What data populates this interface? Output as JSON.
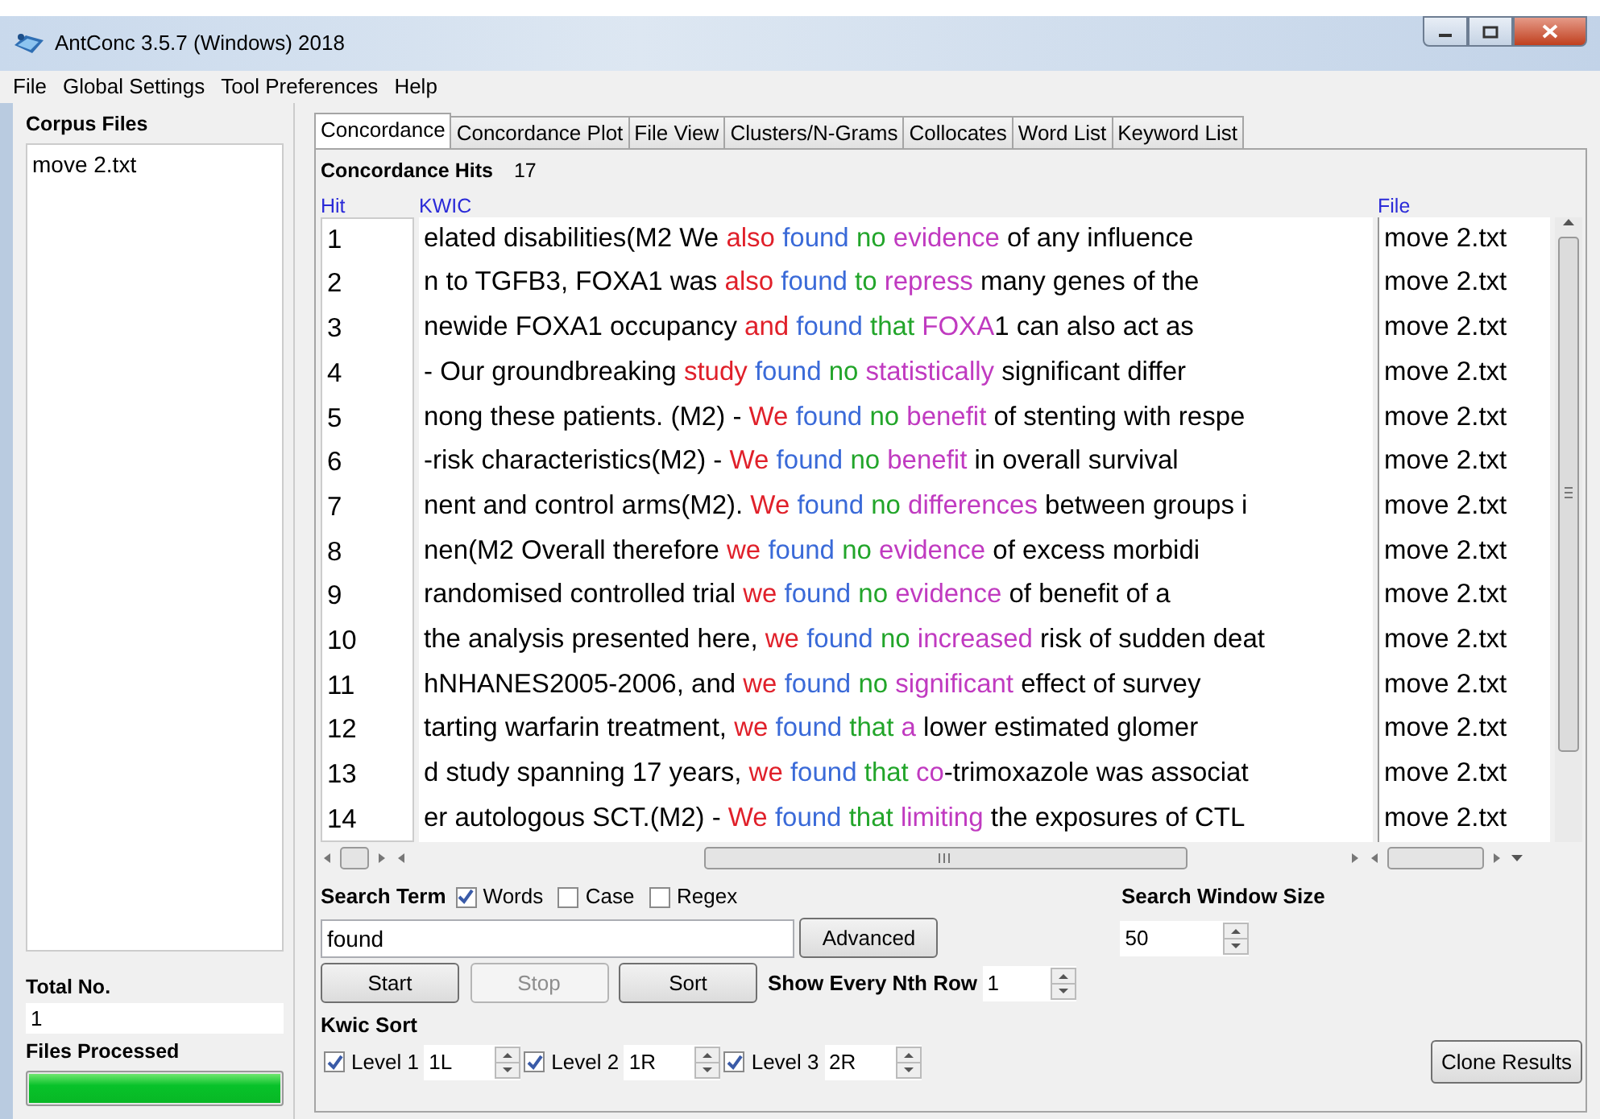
{
  "window": {
    "title": "AntConc 3.5.7 (Windows) 2018"
  },
  "menu": [
    "File",
    "Global Settings",
    "Tool Preferences",
    "Help"
  ],
  "corpus_files": {
    "heading": "Corpus Files",
    "items": [
      "move 2.txt"
    ]
  },
  "total_no": {
    "label": "Total No.",
    "value": "1"
  },
  "files_processed": {
    "label": "Files Processed",
    "level": 1
  },
  "tabs": [
    {
      "label": "Concordance",
      "selected": true
    },
    {
      "label": "Concordance Plot",
      "selected": false
    },
    {
      "label": "File View",
      "selected": false
    },
    {
      "label": "Clusters/N-Grams",
      "selected": false
    },
    {
      "label": "Collocates",
      "selected": false
    },
    {
      "label": "Word List",
      "selected": false
    },
    {
      "label": "Keyword List",
      "selected": false
    }
  ],
  "hits": {
    "label": "Concordance Hits",
    "value": "17"
  },
  "table": {
    "columns": [
      "Hit",
      "KWIC",
      "File"
    ],
    "rows": [
      {
        "hit": "1",
        "kwic": [
          {
            "kind": "context",
            "text": "elated disabilities(M2 We "
          },
          {
            "kind": "l1",
            "text": "also"
          },
          {
            "kind": "hit",
            "text": " found "
          },
          {
            "kind": "r1",
            "text": "no"
          },
          {
            "kind": "r2",
            "text": " evidence"
          },
          {
            "kind": "context",
            "text": " of any influence"
          }
        ],
        "file": "move 2.txt"
      },
      {
        "hit": "2",
        "kwic": [
          {
            "kind": "context",
            "text": "n to TGFB3, FOXA1 was "
          },
          {
            "kind": "l1",
            "text": "also"
          },
          {
            "kind": "hit",
            "text": " found "
          },
          {
            "kind": "r1",
            "text": "to"
          },
          {
            "kind": "r2",
            "text": " repress"
          },
          {
            "kind": "context",
            "text": " many genes of the"
          }
        ],
        "file": "move 2.txt"
      },
      {
        "hit": "3",
        "kwic": [
          {
            "kind": "context",
            "text": "newide FOXA1 occupancy "
          },
          {
            "kind": "l1",
            "text": "and"
          },
          {
            "kind": "hit",
            "text": " found "
          },
          {
            "kind": "r1",
            "text": "that"
          },
          {
            "kind": "r2",
            "text": " FOXA"
          },
          {
            "kind": "context",
            "text": "1 can also act as"
          }
        ],
        "file": "move 2.txt"
      },
      {
        "hit": "4",
        "kwic": [
          {
            "kind": "context",
            "text": "- Our groundbreaking "
          },
          {
            "kind": "l1",
            "text": "study"
          },
          {
            "kind": "hit",
            "text": " found "
          },
          {
            "kind": "r1",
            "text": "no"
          },
          {
            "kind": "r2",
            "text": " statistically"
          },
          {
            "kind": "context",
            "text": " significant differ"
          }
        ],
        "file": "move 2.txt"
      },
      {
        "hit": "5",
        "kwic": [
          {
            "kind": "context",
            "text": "nong these patients. (M2) - "
          },
          {
            "kind": "l1",
            "text": "We"
          },
          {
            "kind": "hit",
            "text": " found "
          },
          {
            "kind": "r1",
            "text": "no"
          },
          {
            "kind": "r2",
            "text": " benefit"
          },
          {
            "kind": "context",
            "text": " of stenting with respe"
          }
        ],
        "file": "move 2.txt"
      },
      {
        "hit": "6",
        "kwic": [
          {
            "kind": "context",
            "text": "-risk characteristics(M2) - "
          },
          {
            "kind": "l1",
            "text": "We"
          },
          {
            "kind": "hit",
            "text": " found "
          },
          {
            "kind": "r1",
            "text": "no"
          },
          {
            "kind": "r2",
            "text": " benefit"
          },
          {
            "kind": "context",
            "text": " in overall survival"
          }
        ],
        "file": "move 2.txt"
      },
      {
        "hit": "7",
        "kwic": [
          {
            "kind": "context",
            "text": "nent and control arms(M2). "
          },
          {
            "kind": "l1",
            "text": "We"
          },
          {
            "kind": "hit",
            "text": " found "
          },
          {
            "kind": "r1",
            "text": "no"
          },
          {
            "kind": "r2",
            "text": " differences"
          },
          {
            "kind": "context",
            "text": " between groups i"
          }
        ],
        "file": "move 2.txt"
      },
      {
        "hit": "8",
        "kwic": [
          {
            "kind": "context",
            "text": "nen(M2 Overall therefore "
          },
          {
            "kind": "l1",
            "text": "we"
          },
          {
            "kind": "hit",
            "text": " found "
          },
          {
            "kind": "r1",
            "text": "no"
          },
          {
            "kind": "r2",
            "text": " evidence"
          },
          {
            "kind": "context",
            "text": " of excess morbidi"
          }
        ],
        "file": "move 2.txt"
      },
      {
        "hit": "9",
        "kwic": [
          {
            "kind": "context",
            "text": "randomised controlled trial "
          },
          {
            "kind": "l1",
            "text": "we"
          },
          {
            "kind": "hit",
            "text": " found "
          },
          {
            "kind": "r1",
            "text": "no"
          },
          {
            "kind": "r2",
            "text": " evidence"
          },
          {
            "kind": "context",
            "text": " of benefit of a"
          }
        ],
        "file": "move 2.txt"
      },
      {
        "hit": "10",
        "kwic": [
          {
            "kind": "context",
            "text": "the analysis presented here, "
          },
          {
            "kind": "l1",
            "text": "we"
          },
          {
            "kind": "hit",
            "text": " found "
          },
          {
            "kind": "r1",
            "text": "no"
          },
          {
            "kind": "r2",
            "text": " increased"
          },
          {
            "kind": "context",
            "text": " risk of sudden deat"
          }
        ],
        "file": "move 2.txt"
      },
      {
        "hit": "11",
        "kwic": [
          {
            "kind": "context",
            "text": "hNHANES2005-2006, and "
          },
          {
            "kind": "l1",
            "text": "we"
          },
          {
            "kind": "hit",
            "text": " found "
          },
          {
            "kind": "r1",
            "text": "no"
          },
          {
            "kind": "r2",
            "text": " significant"
          },
          {
            "kind": "context",
            "text": " effect of survey"
          }
        ],
        "file": "move 2.txt"
      },
      {
        "hit": "12",
        "kwic": [
          {
            "kind": "context",
            "text": "tarting warfarin treatment, "
          },
          {
            "kind": "l1",
            "text": "we"
          },
          {
            "kind": "hit",
            "text": " found "
          },
          {
            "kind": "r1",
            "text": "that"
          },
          {
            "kind": "r2",
            "text": " a"
          },
          {
            "kind": "context",
            "text": " lower estimated glomer"
          }
        ],
        "file": "move 2.txt"
      },
      {
        "hit": "13",
        "kwic": [
          {
            "kind": "context",
            "text": "d study spanning 17 years, "
          },
          {
            "kind": "l1",
            "text": "we"
          },
          {
            "kind": "hit",
            "text": " found "
          },
          {
            "kind": "r1",
            "text": "that"
          },
          {
            "kind": "r2",
            "text": " co"
          },
          {
            "kind": "context",
            "text": "-trimoxazole was associat"
          }
        ],
        "file": "move 2.txt"
      },
      {
        "hit": "14",
        "kwic": [
          {
            "kind": "context",
            "text": "er autologous SCT.(M2) - "
          },
          {
            "kind": "l1",
            "text": "We"
          },
          {
            "kind": "hit",
            "text": " found "
          },
          {
            "kind": "r1",
            "text": "that"
          },
          {
            "kind": "r2",
            "text": " limiting"
          },
          {
            "kind": "context",
            "text": " the exposures of CTL"
          }
        ],
        "file": "move 2.txt"
      }
    ]
  },
  "search": {
    "label": "Search Term",
    "options": [
      {
        "label": "Words",
        "checked": true
      },
      {
        "label": "Case",
        "checked": false
      },
      {
        "label": "Regex",
        "checked": false
      }
    ],
    "value": "found",
    "advanced": "Advanced"
  },
  "window_size": {
    "label": "Search Window Size",
    "value": "50"
  },
  "buttons": [
    {
      "label": "Start",
      "disabled": false
    },
    {
      "label": "Stop",
      "disabled": true
    },
    {
      "label": "Sort",
      "disabled": false
    }
  ],
  "nth_row": {
    "label": "Show Every Nth Row",
    "value": "1"
  },
  "kwic_sort": {
    "label": "Kwic Sort",
    "levels": [
      {
        "label": "Level 1",
        "checked": true,
        "value": "1L"
      },
      {
        "label": "Level 2",
        "checked": true,
        "value": "1R"
      },
      {
        "label": "Level 3",
        "checked": true,
        "value": "2R"
      }
    ]
  },
  "clone_button": "Clone Results"
}
